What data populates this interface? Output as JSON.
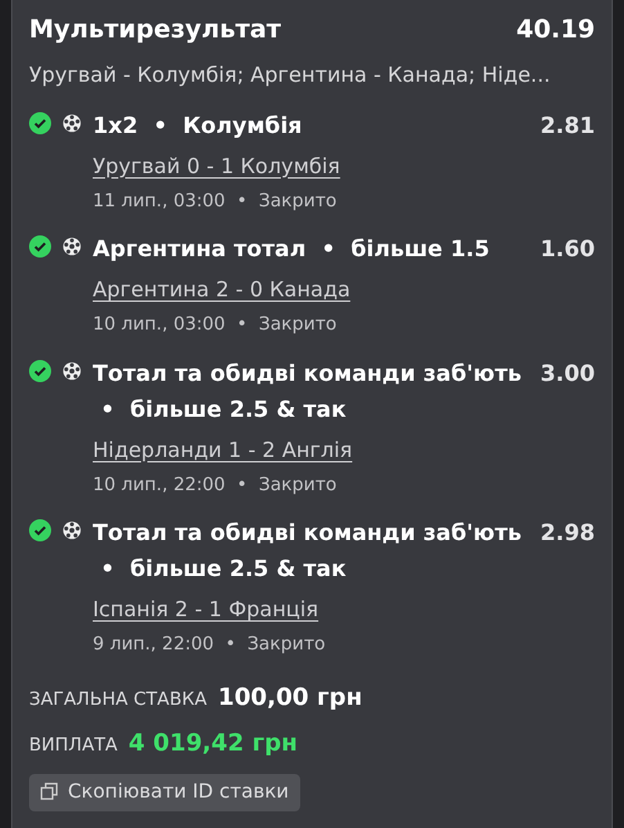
{
  "bet": {
    "title": "Мультирезультат",
    "odds": "40.19",
    "events_summary": "Уругвай - Колумбія; Аргентина - Канада; Ніде..."
  },
  "selections": [
    {
      "won": true,
      "selection": "1x2  •  Колумбія",
      "odds": "2.81",
      "match": "Уругвай 0 - 1 Колумбія",
      "info": "11 лип., 03:00  •  Закрито"
    },
    {
      "won": true,
      "selection": "Аргентина тотал  •  більше 1.5",
      "odds": "1.60",
      "match": "Аргентина 2 - 0 Канада",
      "info": "10 лип., 03:00  •  Закрито"
    },
    {
      "won": true,
      "selection": "Тотал та обидві команди заб'ють  •  більше 2.5 & так",
      "odds": "3.00",
      "match": "Нідерланди 1 - 2 Англія",
      "info": "10 лип., 22:00  •  Закрито"
    },
    {
      "won": true,
      "selection": "Тотал та обидві команди заб'ють  •  більше 2.5 & так",
      "odds": "2.98",
      "match": "Іспанія 2 - 1 Франція",
      "info": "9 лип., 22:00  •  Закрито"
    }
  ],
  "total_stake": {
    "label": "ЗАГАЛЬНА СТАВКА",
    "value": "100,00 грн"
  },
  "payout": {
    "label": "ВИПЛАТА",
    "value": "4 019,42 грн"
  },
  "copy_button": {
    "label": "Скопіювати ID ставки"
  }
}
